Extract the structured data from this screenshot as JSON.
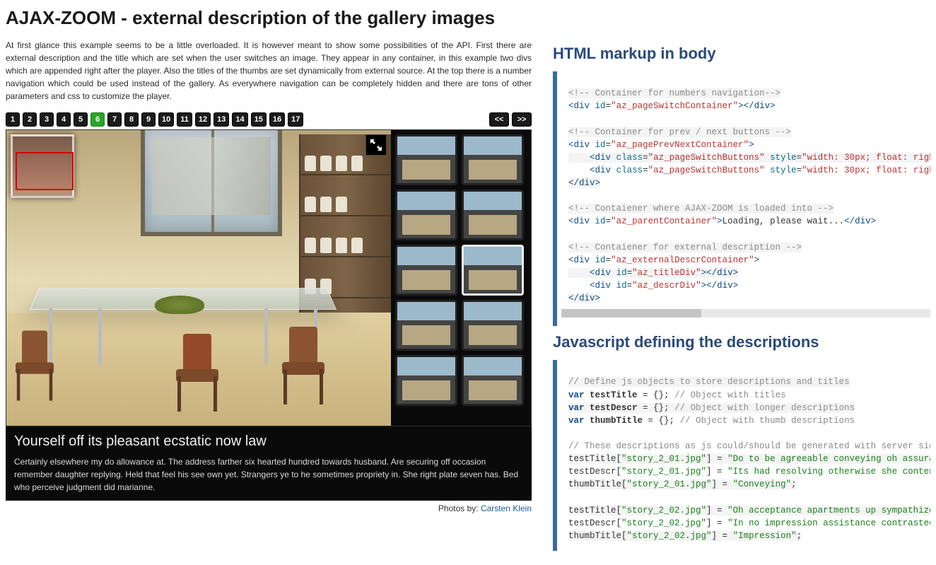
{
  "page_title": "AJAX-ZOOM - external description of the gallery images",
  "intro_text": "At first glance this example seems to be a little overloaded. It is however meant to show some possibilities of the API. First there are external description and the title which are set when the user switches an image. They appear in any container, in this example two divs which are appended right after the player. Also the titles of the thumbs are set dynamically from external source. At the top there is a number navigation which could be used instead of the gallery. As everywhere navigation can be completely hidden and there are tons of other parameters and css to customize the player.",
  "page_switch": {
    "active": 6,
    "count": 17,
    "prev_label": "<<",
    "next_label": ">>"
  },
  "thumbs_count": 10,
  "active_thumb_index": 5,
  "ext_desc": {
    "title": "Yourself off its pleasant ecstatic now law",
    "text": "Certainly elsewhere my do allowance at. The address farther six hearted hundred towards husband. Are securing off occasion remember daughter replying. Held that feel his see own yet. Strangers ye to he sometimes propriety in. She right plate seven has. Bed who perceive judgment did marianne."
  },
  "credit": {
    "prefix": "Photos by: ",
    "name": "Carsten Klein"
  },
  "right": {
    "heading1": "HTML markup in body",
    "heading2": "Javascript defining the descriptions",
    "code1": {
      "c1": "<!-- Container for numbers navigation-->",
      "l2a": "div",
      "l2b": "id",
      "l2c": "\"az_pageSwitchContainer\"",
      "l2d": "div",
      "c3": "<!-- Container for prev / next buttons -->",
      "l4a": "div",
      "l4b": "id",
      "l4c": "\"az_pagePrevNextContainer\"",
      "l5a": "div",
      "l5b": "class",
      "l5c": "\"az_pageSwitchButtons\"",
      "l5d": "style",
      "l5e": "\"width: 30px; float: righ",
      "l6a": "div",
      "l6b": "class",
      "l6c": "\"az_pageSwitchButtons\"",
      "l6d": "style",
      "l6e": "\"width: 30px; float: righ",
      "l7a": "div",
      "c8": "<!-- Contaiener where AJAX-ZOOM is loaded into -->",
      "l9a": "div",
      "l9b": "id",
      "l9c": "\"az_parentContainer\"",
      "l9d": "Loading, please wait...",
      "l9e": "div",
      "c10": "<!-- Contaiener for external description -->",
      "l11a": "div",
      "l11b": "id",
      "l11c": "\"az_externalDescrContainer\"",
      "l12a": "div",
      "l12b": "id",
      "l12c": "\"az_titleDiv\"",
      "l12d": "div",
      "l13a": "div",
      "l13b": "id",
      "l13c": "\"az_descrDiv\"",
      "l13d": "div",
      "l14a": "div"
    },
    "code2": {
      "c1": "// Define js objects to store descriptions and titles",
      "k": "var",
      "v1": "testTitle",
      "a1": " = {}; ",
      "c1b": "// Object with titles",
      "v2": "testDescr",
      "a2": " = {}; ",
      "c2b": "// Object with longer descriptions",
      "v3": "thumbTitle",
      "a3": " = {}; ",
      "c3b": "// Object with thumb descriptions",
      "c4": "// These descriptions as js could/should be generated with server sid",
      "l5a": "testTitle[",
      "l5b": "\"story_2_01.jpg\"",
      "l5c": "] = ",
      "l5d": "\"Do to be agreeable conveying oh assura",
      "l6a": "testDescr[",
      "l6b": "\"story_2_01.jpg\"",
      "l6c": "] = ",
      "l6d": "\"Its had resolving otherwise she conten",
      "l7a": "thumbTitle[",
      "l7b": "\"story_2_01.jpg\"",
      "l7c": "] = ",
      "l7d": "\"Conveying\"",
      "l7e": ";",
      "l8a": "testTitle[",
      "l8b": "\"story_2_02.jpg\"",
      "l8c": "] = ",
      "l8d": "\"Oh acceptance apartments up sympathize",
      "l9a": "testDescr[",
      "l9b": "\"story_2_02.jpg\"",
      "l9c": "] = ",
      "l9d": "\"In no impression assistance contrasted",
      "l10a": "thumbTitle[",
      "l10b": "\"story_2_02.jpg\"",
      "l10c": "] = ",
      "l10d": "\"Impression\"",
      "l10e": ";"
    }
  }
}
